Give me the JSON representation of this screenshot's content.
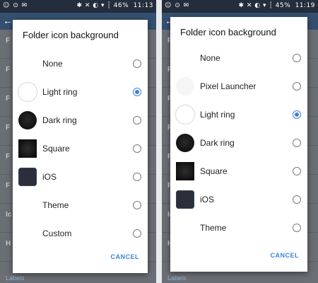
{
  "left": {
    "status": {
      "icons": "☺ ⊙ ✉",
      "right_icons": "✱ ✕ ◐ ▾ ┆",
      "battery": "46%",
      "time": "11:13"
    },
    "background": {
      "rows": [
        {
          "label": "F"
        },
        {
          "label": "F"
        },
        {
          "label": "F"
        },
        {
          "label": "F"
        },
        {
          "label": "F"
        },
        {
          "label": "F"
        },
        {
          "label": "Ic"
        },
        {
          "label": "H"
        }
      ],
      "footer": "Labels"
    },
    "dialog": {
      "title": "Folder icon background",
      "options": [
        {
          "label": "None",
          "checked": false
        },
        {
          "label": "Light ring",
          "checked": true
        },
        {
          "label": "Dark ring",
          "checked": false
        },
        {
          "label": "Square",
          "checked": false
        },
        {
          "label": "iOS",
          "checked": false
        },
        {
          "label": "Theme",
          "checked": false
        },
        {
          "label": "Custom",
          "checked": false
        }
      ],
      "cancel": "CANCEL"
    }
  },
  "right": {
    "status": {
      "icons": "☺ ⊙ ✉",
      "right_icons": "✱ ✕ ◐ ▾ ┆",
      "battery": "45%",
      "time": "11:19"
    },
    "background": {
      "rows": [
        {
          "label": "F"
        },
        {
          "label": "F"
        },
        {
          "label": "F"
        },
        {
          "label": "F"
        },
        {
          "label": "F"
        },
        {
          "label": "F"
        },
        {
          "label": "Ic"
        },
        {
          "label": "H"
        }
      ],
      "footer": "Labels"
    },
    "dialog": {
      "title": "Folder icon background",
      "options": [
        {
          "label": "None",
          "checked": false
        },
        {
          "label": "Pixel Launcher",
          "checked": false
        },
        {
          "label": "Light ring",
          "checked": true
        },
        {
          "label": "Dark ring",
          "checked": false
        },
        {
          "label": "Square",
          "checked": false
        },
        {
          "label": "iOS",
          "checked": false
        },
        {
          "label": "Theme",
          "checked": false
        }
      ],
      "cancel": "CANCEL"
    }
  },
  "colors": {
    "accent": "#3d82d6",
    "statusbar": "#232d3c",
    "appbar": "#35506f"
  }
}
